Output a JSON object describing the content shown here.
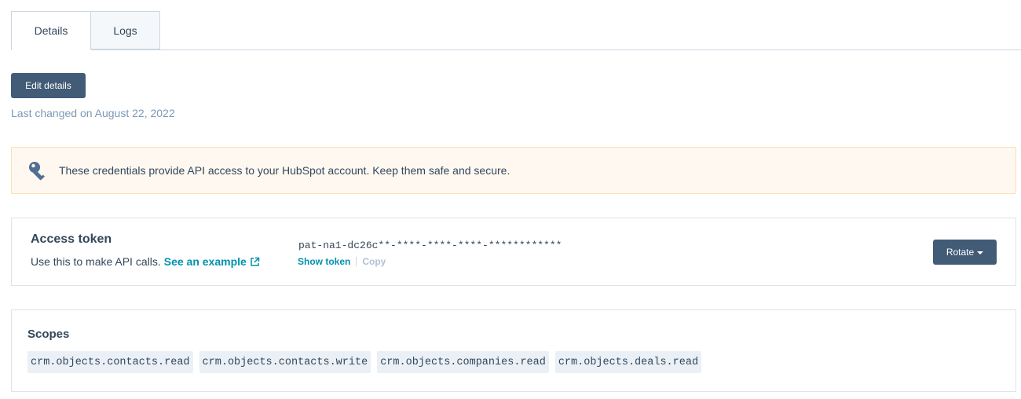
{
  "tabs": [
    {
      "label": "Details",
      "active": true
    },
    {
      "label": "Logs",
      "active": false
    }
  ],
  "edit_button_label": "Edit details",
  "last_changed": "Last changed on August 22, 2022",
  "alert": {
    "icon": "key-icon",
    "text": "These credentials provide API access to your HubSpot account. Keep them safe and secure."
  },
  "access_token": {
    "title": "Access token",
    "description": "Use this to make API calls.",
    "example_link": "See an example",
    "value": "pat-na1-dc26c**-****-****-****-************",
    "show_token": "Show token",
    "copy": "Copy",
    "rotate_label": "Rotate"
  },
  "scopes": {
    "title": "Scopes",
    "items": [
      "crm.objects.contacts.read",
      "crm.objects.contacts.write",
      "crm.objects.companies.read",
      "crm.objects.deals.read"
    ]
  },
  "colors": {
    "primary_button": "#425b76",
    "link": "#0091ae",
    "alert_bg": "#fef8f0",
    "alert_border": "#fae0b5",
    "muted_text": "#7c98b6"
  }
}
